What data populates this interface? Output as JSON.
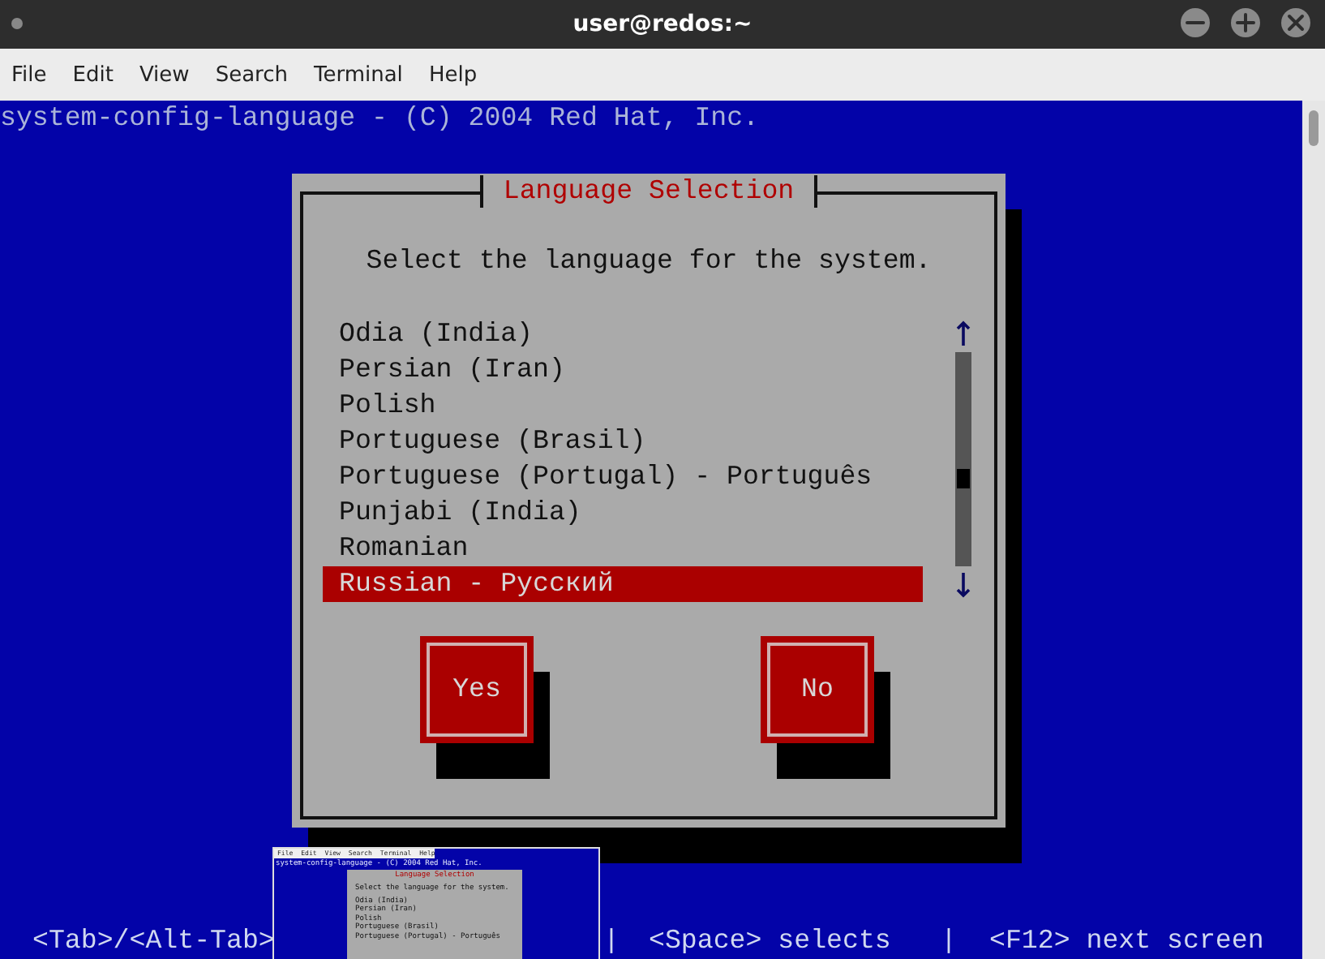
{
  "window": {
    "title": "user@redos:~"
  },
  "menu": [
    "File",
    "Edit",
    "View",
    "Search",
    "Terminal",
    "Help"
  ],
  "terminal": {
    "header": "system-config-language - (C) 2004 Red Hat, Inc.",
    "dialog": {
      "title": "Language Selection",
      "prompt": "Select the language for the system.",
      "items": [
        {
          "label": "Odia (India)",
          "selected": false
        },
        {
          "label": "Persian (Iran)",
          "selected": false
        },
        {
          "label": "Polish",
          "selected": false
        },
        {
          "label": "Portuguese (Brasil)",
          "selected": false
        },
        {
          "label": "Portuguese (Portugal) - Português",
          "selected": false
        },
        {
          "label": "Punjabi (India)",
          "selected": false
        },
        {
          "label": "Romanian",
          "selected": false
        },
        {
          "label": "Russian - Русский",
          "selected": true
        }
      ],
      "buttons": [
        "Yes",
        "No"
      ]
    },
    "hints": [
      "<Tab>/<Alt-Tab>",
      "|",
      "<Space> selects",
      "|",
      "<F12> next screen"
    ]
  },
  "thumbnail": {
    "menu": [
      "File",
      "Edit",
      "View",
      "Search",
      "Terminal",
      "Help"
    ],
    "header": "system-config-language - (C) 2004 Red Hat, Inc.",
    "dialog_title": "Language Selection",
    "prompt": "Select the language for the system.",
    "items": [
      "Odia (India)",
      "Persian (Iran)",
      "Polish",
      "Portuguese (Brasil)",
      "Portuguese (Portugal) - Português"
    ]
  }
}
